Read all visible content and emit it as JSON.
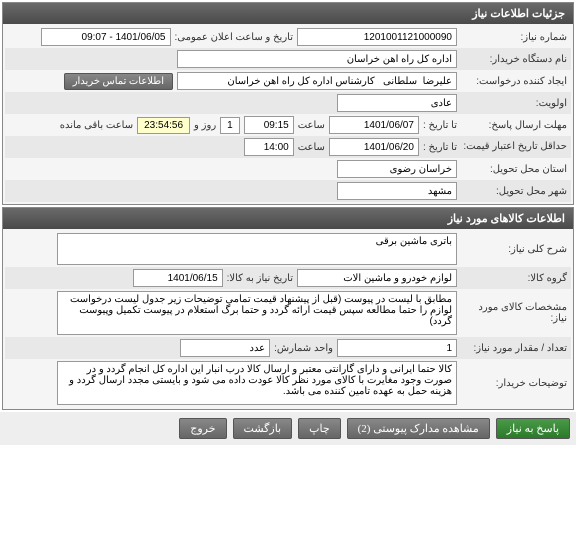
{
  "panel1": {
    "title": "جزئیات اطلاعات نیاز",
    "fields": {
      "need_no_label": "شماره نیاز:",
      "need_no": "1201001121000090",
      "announce_dt_label": "تاریخ و ساعت اعلان عمومی:",
      "announce_dt": "1401/06/05 - 09:07",
      "buyer_label": "نام دستگاه خریدار:",
      "buyer": "اداره کل راه آهن خراسان",
      "requester_label": "ایجاد کننده درخواست:",
      "requester": "علیرضا  سلطانی   کارشناس اداره کل راه آهن خراسان",
      "contact_btn": "اطلاعات تماس خریدار",
      "priority_label": "اولویت:",
      "priority": "عادی",
      "reply_deadline_label": "مهلت ارسال پاسخ:",
      "to_date_label": "تا تاریخ :",
      "reply_date": "1401/06/07",
      "time_label": "ساعت",
      "reply_time": "09:15",
      "days_val": "1",
      "days_label": "روز و",
      "remaining_time": "23:54:56",
      "remaining_label": "ساعت باقی مانده",
      "validity_label": "حداقل تاریخ اعتبار قیمت:",
      "validity_date": "1401/06/20",
      "validity_time": "14:00",
      "province_label": "استان محل تحویل:",
      "province": "خراسان رضوی",
      "city_label": "شهر محل تحویل:",
      "city": "مشهد"
    }
  },
  "panel2": {
    "title": "اطلاعات کالاهای مورد نیاز",
    "fields": {
      "desc_label": "شرح کلی نیاز:",
      "desc": "باتری ماشین برقی",
      "group_label": "گروه کالا:",
      "group": "لوازم خودرو و ماشین آلات",
      "need_date_label": "تاریخ نیاز به کالا:",
      "need_date": "1401/06/15",
      "spec_label": "مشخصات کالای مورد نیاز:",
      "spec": "مطابق با لیست در پیوست (قبل از پیشنهاد قیمت تمامی توضیحات زیر جدول لیست درخواست لوازم را حتما مطالعه سپس قیمت ارائه گردد و حتما برگ استعلام در پیوست تکمیل وپیوست گردد)",
      "qty_label": "تعداد / مقدار مورد نیاز:",
      "qty": "1",
      "unit_label": "واحد شمارش:",
      "unit": "عدد",
      "buyer_notes_label": "توضیحات خریدار:",
      "buyer_notes": "کالا حتما ایرانی و دارای گارانتی معتبر و ارسال کالا درب انبار این اداره کل انجام گردد و در صورت وجود مغایرت با کالای مورد نظر کالا عودت داده می شود و بایستی مجدد ارسال گردد و هزینه حمل به عهده تامین کننده می باشد."
    }
  },
  "footer": {
    "reply": "پاسخ به نیاز",
    "attachments": "مشاهده مدارک پیوستی (2)",
    "print": "چاپ",
    "back": "بازگشت",
    "exit": "خروج"
  }
}
